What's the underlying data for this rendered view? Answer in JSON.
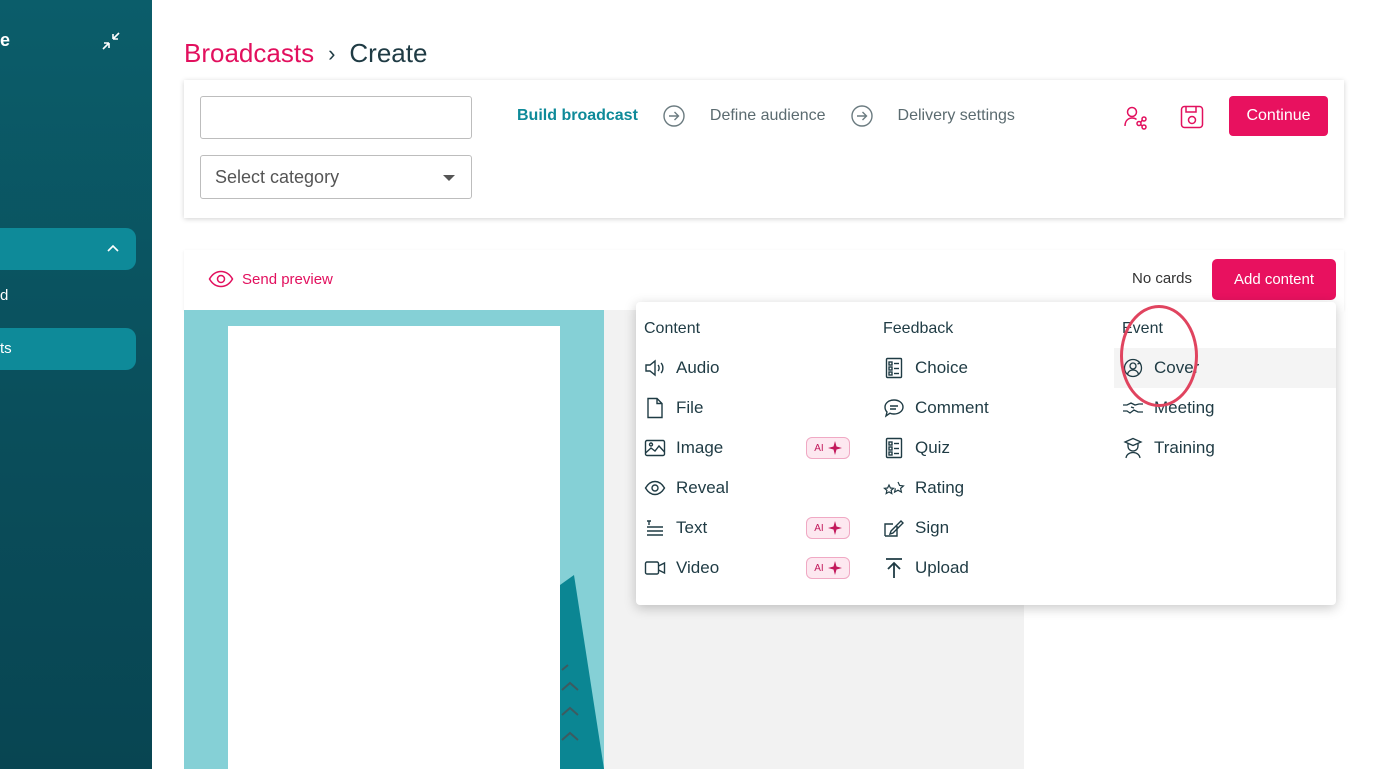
{
  "sidebar": {
    "brand_fragment": "e",
    "item1_fragment": "d",
    "item2_fragment": "ts"
  },
  "breadcrumb": {
    "parent": "Broadcasts",
    "separator": "›",
    "current": "Create"
  },
  "form": {
    "title_value": "",
    "category_placeholder": "Select category"
  },
  "steps": [
    "Build broadcast",
    "Define audience",
    "Delivery settings"
  ],
  "toolbar": {
    "continue_label": "Continue"
  },
  "editor": {
    "send_preview_label": "Send preview",
    "cards_status": "No cards",
    "add_content_label": "Add content"
  },
  "menu": {
    "columns": [
      {
        "heading": "Content",
        "items": [
          {
            "label": "Audio",
            "icon": "speaker-icon"
          },
          {
            "label": "File",
            "icon": "file-icon"
          },
          {
            "label": "Image",
            "icon": "image-icon",
            "ai": true
          },
          {
            "label": "Reveal",
            "icon": "eye-icon"
          },
          {
            "label": "Text",
            "icon": "text-icon",
            "ai": true
          },
          {
            "label": "Video",
            "icon": "video-icon",
            "ai": true
          }
        ]
      },
      {
        "heading": "Feedback",
        "items": [
          {
            "label": "Choice",
            "icon": "checklist-icon"
          },
          {
            "label": "Comment",
            "icon": "comment-icon"
          },
          {
            "label": "Quiz",
            "icon": "quiz-icon"
          },
          {
            "label": "Rating",
            "icon": "stars-icon"
          },
          {
            "label": "Sign",
            "icon": "sign-icon"
          },
          {
            "label": "Upload",
            "icon": "upload-icon"
          }
        ]
      },
      {
        "heading": "Event",
        "items": [
          {
            "label": "Cover",
            "icon": "cover-icon"
          },
          {
            "label": "Meeting",
            "icon": "handshake-icon"
          },
          {
            "label": "Training",
            "icon": "training-icon"
          }
        ]
      }
    ],
    "ai_badge": "AI"
  },
  "colors": {
    "brand_pink": "#e8115f",
    "teal_dark": "#0b5d6a",
    "teal_accent": "#0e8a99",
    "canvas_teal": "#85d0d6"
  }
}
